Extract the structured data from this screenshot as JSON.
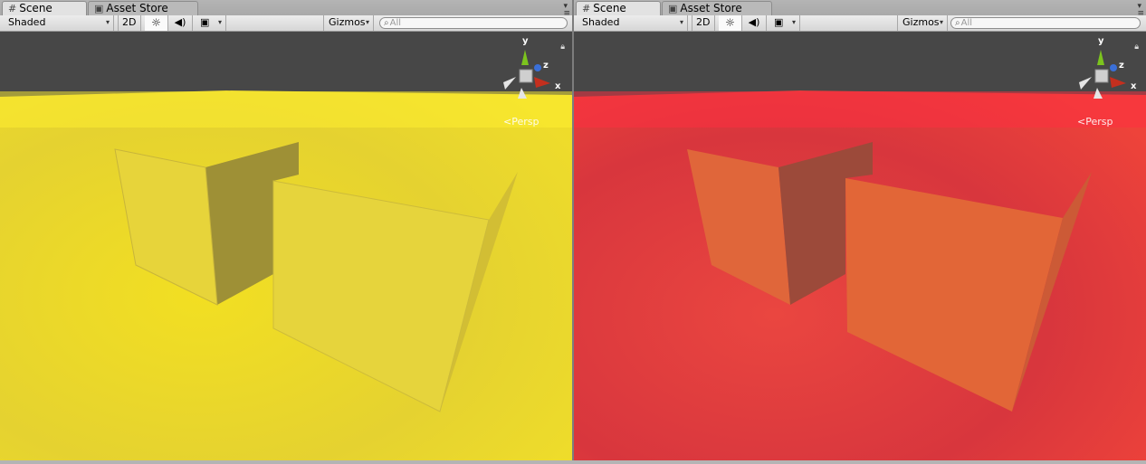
{
  "panels": [
    {
      "tabs": [
        {
          "label": "Scene",
          "icon": "grid-icon"
        },
        {
          "label": "Asset Store",
          "icon": "store-icon"
        }
      ],
      "toolbar": {
        "shading": "Shaded",
        "mode_2d": "2D",
        "gizmos": "Gizmos",
        "search_placeholder": "All"
      },
      "gizmo_axes": {
        "x": "x",
        "y": "y",
        "z": "z"
      },
      "projection": "Persp",
      "environment": {
        "sky": "#474747",
        "ground": "#f1dd28"
      }
    },
    {
      "tabs": [
        {
          "label": "Scene",
          "icon": "grid-icon"
        },
        {
          "label": "Asset Store",
          "icon": "store-icon"
        }
      ],
      "toolbar": {
        "shading": "Shaded",
        "mode_2d": "2D",
        "gizmos": "Gizmos",
        "search_placeholder": "All"
      },
      "gizmo_axes": {
        "x": "x",
        "y": "y",
        "z": "z"
      },
      "projection": "Persp",
      "environment": {
        "sky": "#474747",
        "ground": "#ec3b3e"
      }
    }
  ]
}
